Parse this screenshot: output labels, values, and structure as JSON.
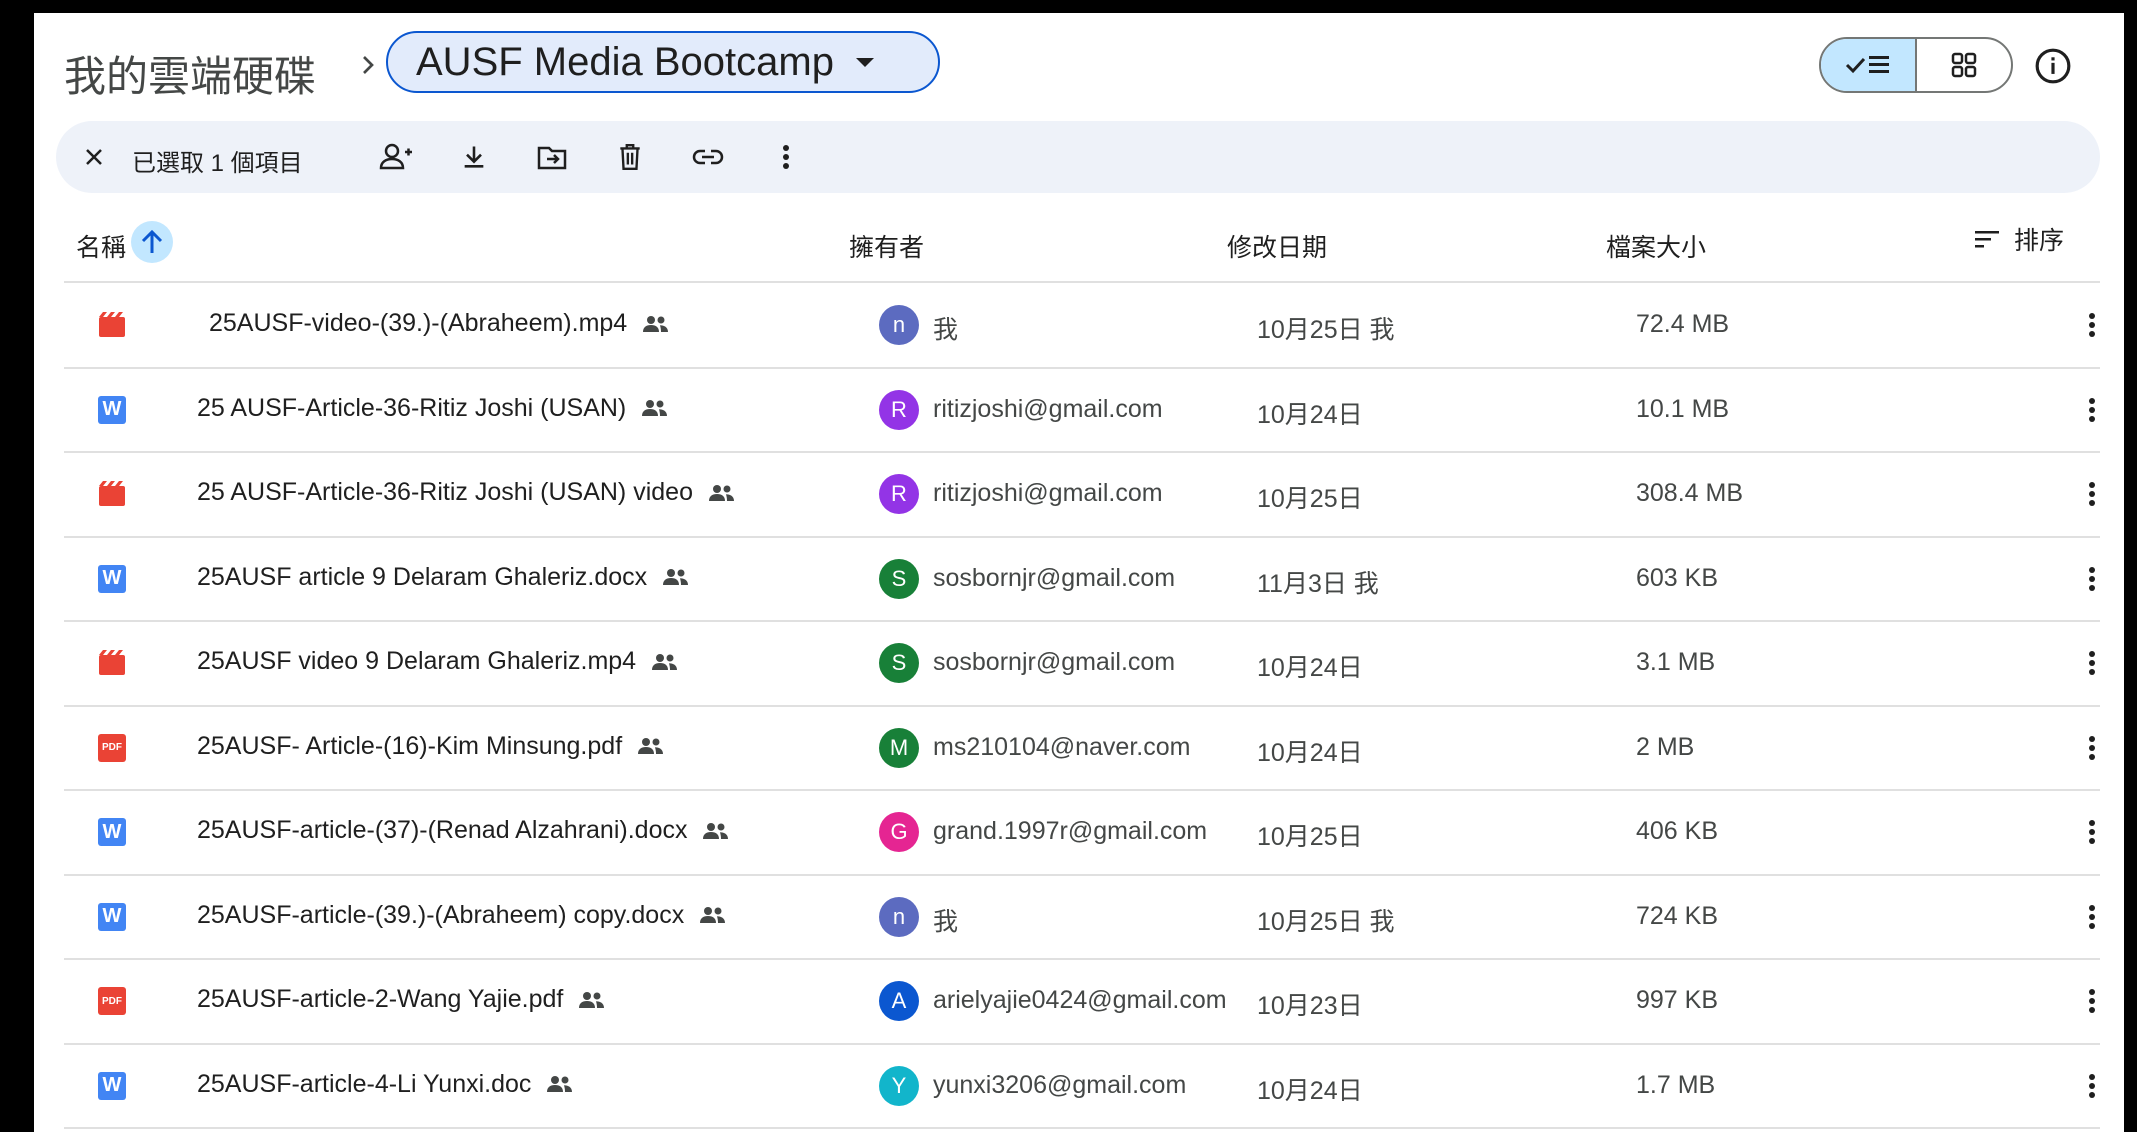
{
  "breadcrumb": {
    "root": "我的雲端硬碟",
    "current": "AUSF Media Bootcamp"
  },
  "toolbar": {
    "selected_count": "已選取 1 個項目"
  },
  "columns": {
    "name": "名稱",
    "owner": "擁有者",
    "modified": "修改日期",
    "size": "檔案大小",
    "sort": "排序"
  },
  "files": [
    {
      "name": "25AUSF-video-(39.)-(Abraheem).mp4",
      "type": "video",
      "owner_initial": "n",
      "owner": "我",
      "avatar_color": "#5c6bc0",
      "modified": "10月25日 我",
      "size": "72.4 MB"
    },
    {
      "name": "25 AUSF-Article-36-Ritiz Joshi (USAN)",
      "type": "word",
      "owner_initial": "R",
      "owner": "ritizjoshi@gmail.com",
      "avatar_color": "#9334e6",
      "modified": "10月24日",
      "size": "10.1 MB"
    },
    {
      "name": "25 AUSF-Article-36-Ritiz Joshi (USAN) video",
      "type": "video",
      "owner_initial": "R",
      "owner": "ritizjoshi@gmail.com",
      "avatar_color": "#9334e6",
      "modified": "10月25日",
      "size": "308.4 MB"
    },
    {
      "name": "25AUSF article 9 Delaram Ghaleriz.docx",
      "type": "word",
      "owner_initial": "S",
      "owner": "sosbornjr@gmail.com",
      "avatar_color": "#188038",
      "modified": "11月3日 我",
      "size": "603 KB"
    },
    {
      "name": "25AUSF video 9 Delaram Ghaleriz.mp4",
      "type": "video",
      "owner_initial": "S",
      "owner": "sosbornjr@gmail.com",
      "avatar_color": "#188038",
      "modified": "10月24日",
      "size": "3.1 MB"
    },
    {
      "name": "25AUSF- Article-(16)-Kim Minsung.pdf",
      "type": "pdf",
      "owner_initial": "M",
      "owner": "ms210104@naver.com",
      "avatar_color": "#188038",
      "modified": "10月24日",
      "size": "2 MB"
    },
    {
      "name": "25AUSF-article-(37)-(Renad Alzahrani).docx",
      "type": "word",
      "owner_initial": "G",
      "owner": "grand.1997r@gmail.com",
      "avatar_color": "#e52592",
      "modified": "10月25日",
      "size": "406 KB"
    },
    {
      "name": "25AUSF-article-(39.)-(Abraheem) copy.docx",
      "type": "word",
      "owner_initial": "n",
      "owner": "我",
      "avatar_color": "#5c6bc0",
      "modified": "10月25日 我",
      "size": "724 KB"
    },
    {
      "name": "25AUSF-article-2-Wang Yajie.pdf",
      "type": "pdf",
      "owner_initial": "A",
      "owner": "arielyajie0424@gmail.com",
      "avatar_color": "#0b57d0",
      "modified": "10月23日",
      "size": "997 KB"
    },
    {
      "name": "25AUSF-article-4-Li Yunxi.doc",
      "type": "word",
      "owner_initial": "Y",
      "owner": "yunxi3206@gmail.com",
      "avatar_color": "#12b5cb",
      "modified": "10月24日",
      "size": "1.7 MB"
    }
  ],
  "icons": {
    "pdf_label": "PDF",
    "word_label": "W"
  }
}
